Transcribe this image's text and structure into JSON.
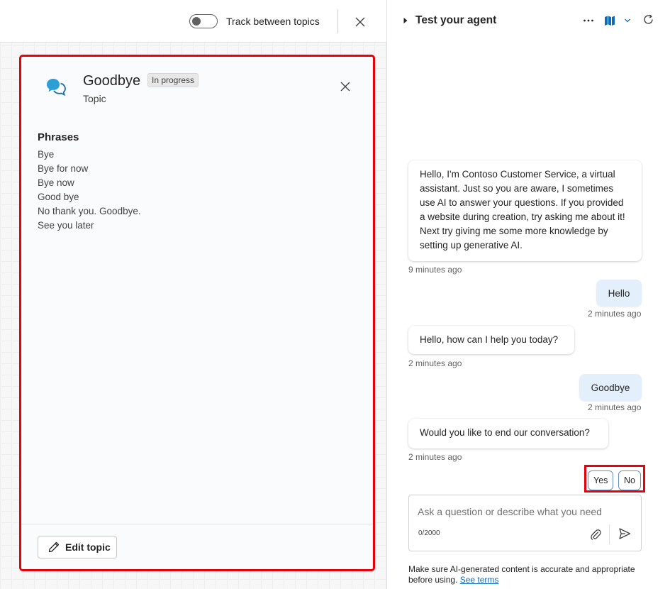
{
  "topbar": {
    "toggle_label": "Track between topics",
    "toggle_on": false
  },
  "topic": {
    "title": "Goodbye",
    "status": "In progress",
    "subtitle": "Topic",
    "phrases_heading": "Phrases",
    "phrases": [
      "Bye",
      "Bye for now",
      "Bye now",
      "Good bye",
      "No thank you. Goodbye.",
      "See you later"
    ],
    "edit_button": "Edit topic"
  },
  "test_pane": {
    "title": "Test your agent",
    "messages": [
      {
        "sender": "bot",
        "text": "Hello, I'm Contoso Customer Service, a virtual assistant. Just so you are aware, I sometimes use AI to answer your questions. If you provided a website during creation, try asking me about it! Next try giving me some more knowledge by setting up generative AI.",
        "time": "9 minutes ago"
      },
      {
        "sender": "user",
        "text": "Hello",
        "time": "2 minutes ago"
      },
      {
        "sender": "bot",
        "text": "Hello, how can I help you today?",
        "time": "2 minutes ago"
      },
      {
        "sender": "user",
        "text": "Goodbye",
        "time": "2 minutes ago"
      },
      {
        "sender": "bot",
        "text": "Would you like to end our conversation?",
        "time": "2 minutes ago"
      }
    ],
    "suggested_actions": [
      "Yes",
      "No"
    ],
    "input": {
      "placeholder": "Ask a question or describe what you need",
      "value": "",
      "char_count": "0/2000"
    },
    "disclaimer": {
      "text": "Make sure AI-generated content is accurate and appropriate before using.",
      "link": "See terms"
    }
  },
  "colors": {
    "highlight_border": "#e8000b",
    "user_bubble": "#e3effb",
    "link": "#0f6cbd",
    "map_icon": "#0f6cbd"
  },
  "icons": {
    "topic": "chat-bubbles-icon",
    "close": "close-icon",
    "edit": "pencil-icon",
    "collapse": "caret-right-icon",
    "more": "more-icon",
    "map": "map-icon",
    "dropdown": "chevron-down-icon",
    "refresh": "refresh-icon",
    "attach": "paperclip-icon",
    "send": "send-icon"
  }
}
